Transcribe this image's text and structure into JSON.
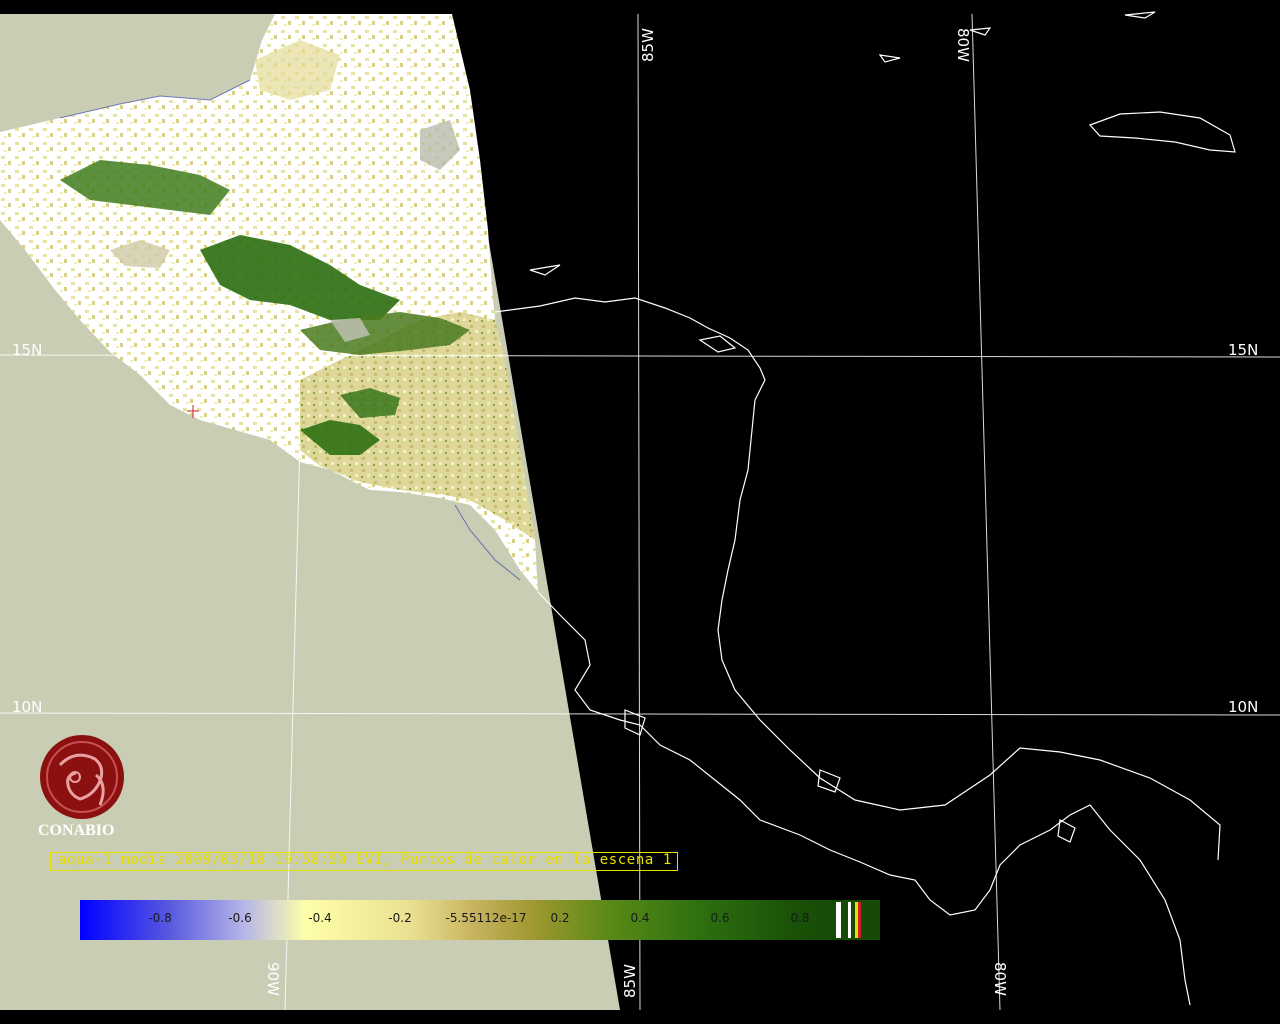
{
  "map": {
    "lat_labels": {
      "left": [
        "15N",
        "10N"
      ],
      "right": [
        "15N",
        "10N"
      ]
    },
    "lon_labels": {
      "top": [
        "85W",
        "80W"
      ],
      "bottom": [
        "90W",
        "85W",
        "80W"
      ]
    }
  },
  "logo": {
    "text": "CONABIO"
  },
  "caption": {
    "text": "aqua-1 modis 2009/03/18 19:58:50 EVI, Puntos de calor en la escena 1"
  },
  "colorbar": {
    "ticks": [
      "-0.8",
      "-0.6",
      "-0.4",
      "-0.2",
      "-5.55112e-17",
      "0.2",
      "0.4",
      "0.6",
      "0.8"
    ],
    "colors": {
      "low": "#0000ff",
      "mid": "#ffffa0",
      "high": "#1f5f00"
    }
  },
  "colors": {
    "swath_background": "#c8cdb4",
    "land_white": "#ffffff",
    "vegetation_dark": "#2b6e10",
    "grid": "#ffffff",
    "caption": "#e8e000",
    "logo": "#8b1010"
  }
}
